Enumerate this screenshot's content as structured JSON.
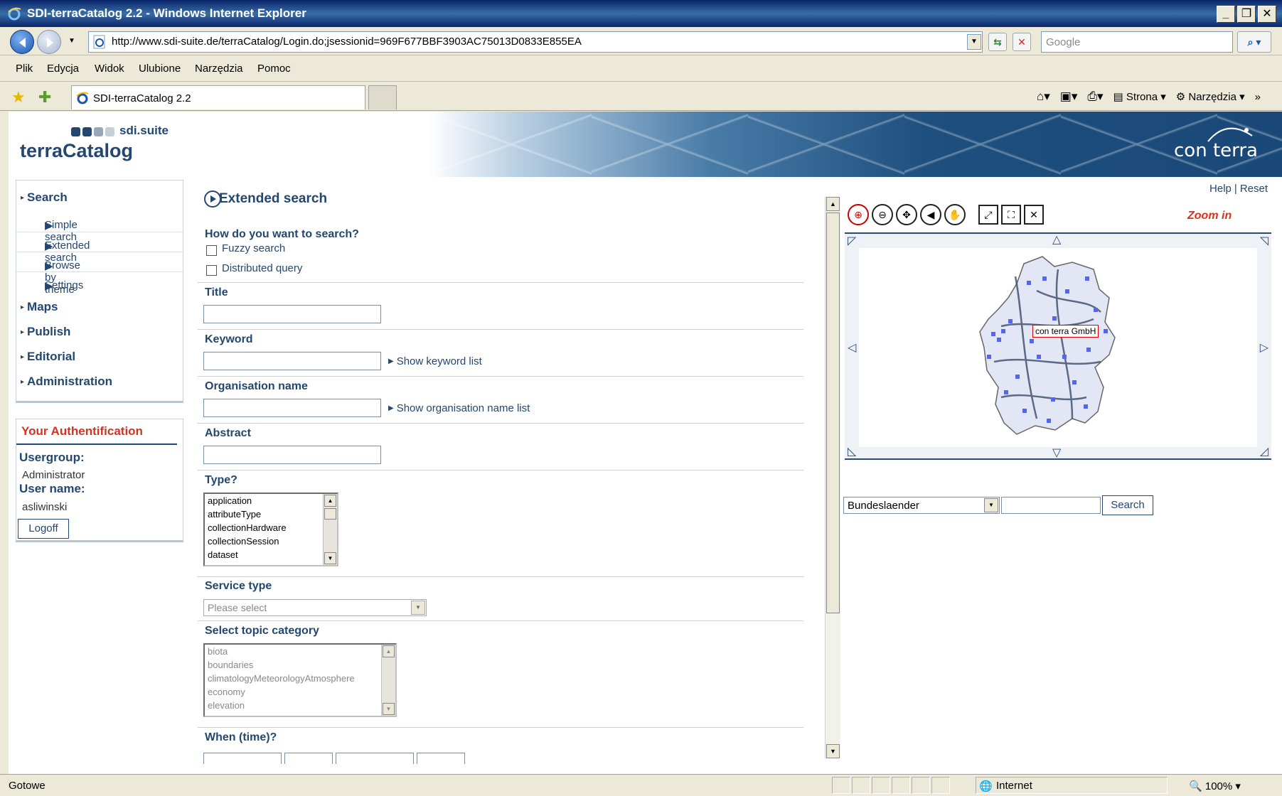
{
  "window": {
    "title": "SDI-terraCatalog 2.2 - Windows Internet Explorer",
    "url": "http://www.sdi-suite.de/terraCatalog/Login.do;jsessionid=969F677BBF3903AC75013D0833E855EA",
    "search_placeholder": "Google",
    "tab_title": "SDI-terraCatalog 2.2"
  },
  "menu": [
    "Plik",
    "Edycja",
    "Widok",
    "Ulubione",
    "Narzędzia",
    "Pomoc"
  ],
  "command_bar": {
    "page": "Strona",
    "tools": "Narzędzia"
  },
  "header": {
    "brand_small": "sdi.suite",
    "brand": "terraCatalog",
    "partner": "con terra",
    "help": "Help",
    "reset": "Reset",
    "dot_colors": [
      "#23476f",
      "#23476f",
      "#9aa7b5",
      "#c6cfd8"
    ]
  },
  "nav": {
    "search": "Search",
    "sub": [
      "Simple search",
      "Extended search",
      "Browse by theme",
      "Settings"
    ],
    "maps": "Maps",
    "publish": "Publish",
    "editorial": "Editorial",
    "administration": "Administration"
  },
  "auth": {
    "title": "Your Authentification",
    "usergroup_label": "Usergroup:",
    "usergroup": "Administrator",
    "username_label": "User name:",
    "username": "asliwinski",
    "logoff": "Logoff"
  },
  "form": {
    "title": "Extended search",
    "how_label": "How do you want to search?",
    "fuzzy": "Fuzzy search",
    "distributed": "Distributed query",
    "title_label": "Title",
    "keyword_label": "Keyword",
    "keyword_link": "Show keyword list",
    "org_label": "Organisation name",
    "org_link": "Show organisation name list",
    "abstract_label": "Abstract",
    "type_label": "Type?",
    "types": [
      "application",
      "attributeType",
      "collectionHardware",
      "collectionSession",
      "dataset"
    ],
    "service_label": "Service type",
    "service_placeholder": "Please select",
    "topic_label": "Select topic category",
    "topics": [
      "biota",
      "boundaries",
      "climatologyMeteorologyAtmosphere",
      "economy",
      "elevation"
    ],
    "when_label": "When (time)?"
  },
  "map": {
    "zoom_in": "Zoom in",
    "label": "con terra GmbH",
    "layer": "Bundeslaender",
    "search_button": "Search"
  },
  "status": {
    "text": "Gotowe",
    "zone": "Internet",
    "zoom": "100%"
  }
}
